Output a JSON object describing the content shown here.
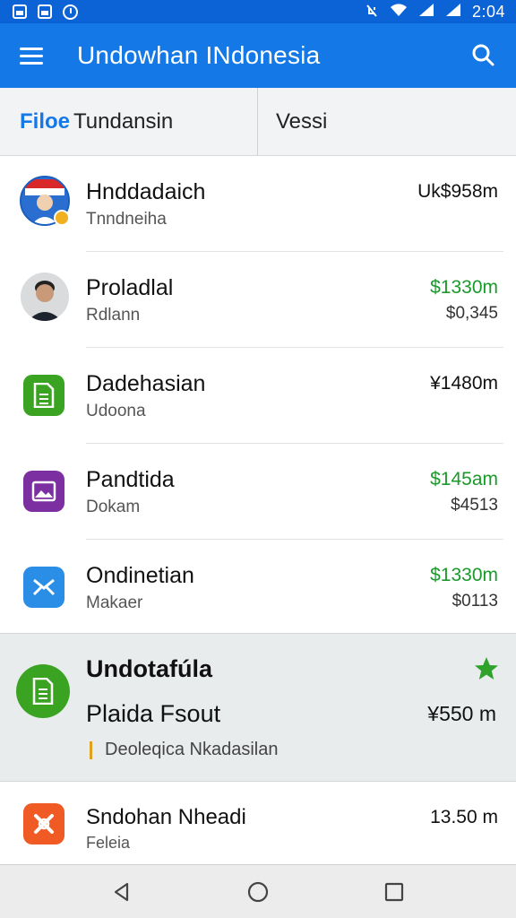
{
  "status_bar": {
    "time": "2:04",
    "left_icons": [
      "image-icon",
      "calendar-icon",
      "alarm-clock-icon"
    ],
    "right_icons": [
      "notifications-off-icon",
      "wifi-icon",
      "signal-icon",
      "signal-icon"
    ]
  },
  "app_bar": {
    "title": "Undowhan INdonesia",
    "menu_icon": "menu-icon",
    "search_icon": "search-icon",
    "color": "#1479e6"
  },
  "tabs": [
    {
      "accent": "Filoe",
      "label": "Tundansin",
      "active": true
    },
    {
      "label": "Vessi",
      "active": false
    }
  ],
  "rows": [
    {
      "title": "Hnddadaich",
      "subtitle": "Tnndneiha",
      "amount": "Uk$958m",
      "amount_color": "#111111",
      "icon": "avatar-flag-icon"
    },
    {
      "title": "Proladlal",
      "subtitle": "Rdlann",
      "amount": "$1330m",
      "amount2": "$0,345",
      "amount_color": "#1a9a2a",
      "icon": "avatar-man-icon"
    },
    {
      "title": "Dadehasian",
      "subtitle": "Udoona",
      "amount": "¥1480m",
      "amount_color": "#111111",
      "icon": "document-icon",
      "icon_color": "#3aa321"
    },
    {
      "title": "Pandtida",
      "subtitle": "Dokam",
      "amount": "$145am",
      "amount2": "$4513",
      "amount_color": "#1a9a2a",
      "icon": "image-icon",
      "icon_color": "#7b2fa0"
    },
    {
      "title": "Ondinetian",
      "subtitle": "Makaer",
      "amount": "$1330m",
      "amount2": "$0113",
      "amount_color": "#1a9a2a",
      "icon": "mail-icon",
      "icon_color": "#2a8de6"
    }
  ],
  "featured": {
    "title": "Undotafúla",
    "line2": "Plaida Fsout",
    "amount": "¥550 m",
    "note": "Deoleqica Nkadasilan",
    "icon": "document-icon",
    "icon_color": "#3aa321",
    "star_icon": "star-icon",
    "star_color": "#2ea22a"
  },
  "last_row": {
    "title": "Sndohan Nheadi",
    "subtitle": "Feleia",
    "amount": "13.50 m",
    "icon": "app-logo-icon",
    "icon_color": "#f05a24"
  },
  "nav_bar": {
    "back_icon": "back-triangle-icon",
    "home_icon": "home-circle-icon",
    "recents_icon": "recents-square-icon"
  }
}
